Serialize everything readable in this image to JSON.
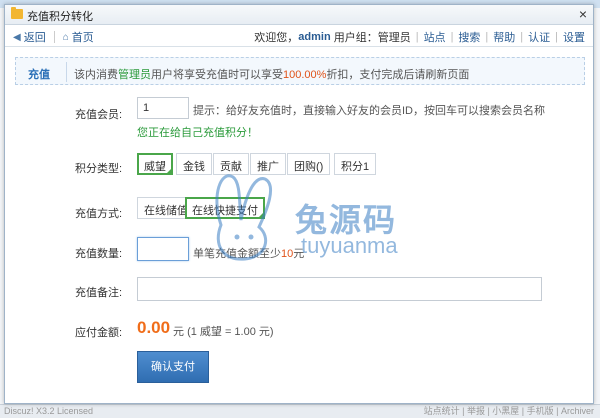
{
  "window": {
    "title": "充值积分转化"
  },
  "toolbar": {
    "back": "返回",
    "home": "首页",
    "greeting": "欢迎您，",
    "username": "admin",
    "group_label": "用户组：管理员",
    "links": [
      "站点",
      "搜索",
      "帮助",
      "认证",
      "设置"
    ]
  },
  "notice": {
    "tag": "充值",
    "text_prefix": "该内消费",
    "role": "管理员",
    "text_mid": "用户将享受充值时可以享受",
    "percent": "100.00%",
    "text_suffix": "折扣，支付完成后请刷新页面"
  },
  "form": {
    "member_label": "充值会员:",
    "member_value": "1",
    "member_hint": "提示：给好友充值时，直接输入好友的会员ID，按回车可以搜索会员名称",
    "member_tip": "您正在给自己充值积分！",
    "type_label": "积分类型:",
    "types": [
      "威望",
      "金钱",
      "贡献",
      "推广",
      "团购()",
      "积分1"
    ],
    "selected_type": "威望",
    "method_label": "充值方式:",
    "methods": [
      "在线储值",
      "在线快捷支付"
    ],
    "selected_method": "在线快捷支付",
    "qty_label": "充值数量:",
    "qty_value": "",
    "qty_hint_prefix": "单笔充值金额至少",
    "qty_min": "10",
    "qty_hint_suffix": "元",
    "remark_label": "充值备注:",
    "remark_value": "",
    "pay_label": "应付金额:",
    "pay_amount": "0.00",
    "pay_unit": "元",
    "pay_rate": "(1 威望 = 1.00 元)",
    "submit_label": "确认支付"
  },
  "watermark": {
    "cn": "兔源码",
    "en": "tuyuanma"
  },
  "footer": {
    "left": "Discuz! X3.2 Licensed",
    "right": "站点统计 | 举报 | 小黑屋 | 手机版 | Archiver"
  },
  "colors": {
    "accent": "#2a5c93",
    "green": "#2a9a3a",
    "orange": "#f06d1a",
    "button": "#2f6db1"
  }
}
